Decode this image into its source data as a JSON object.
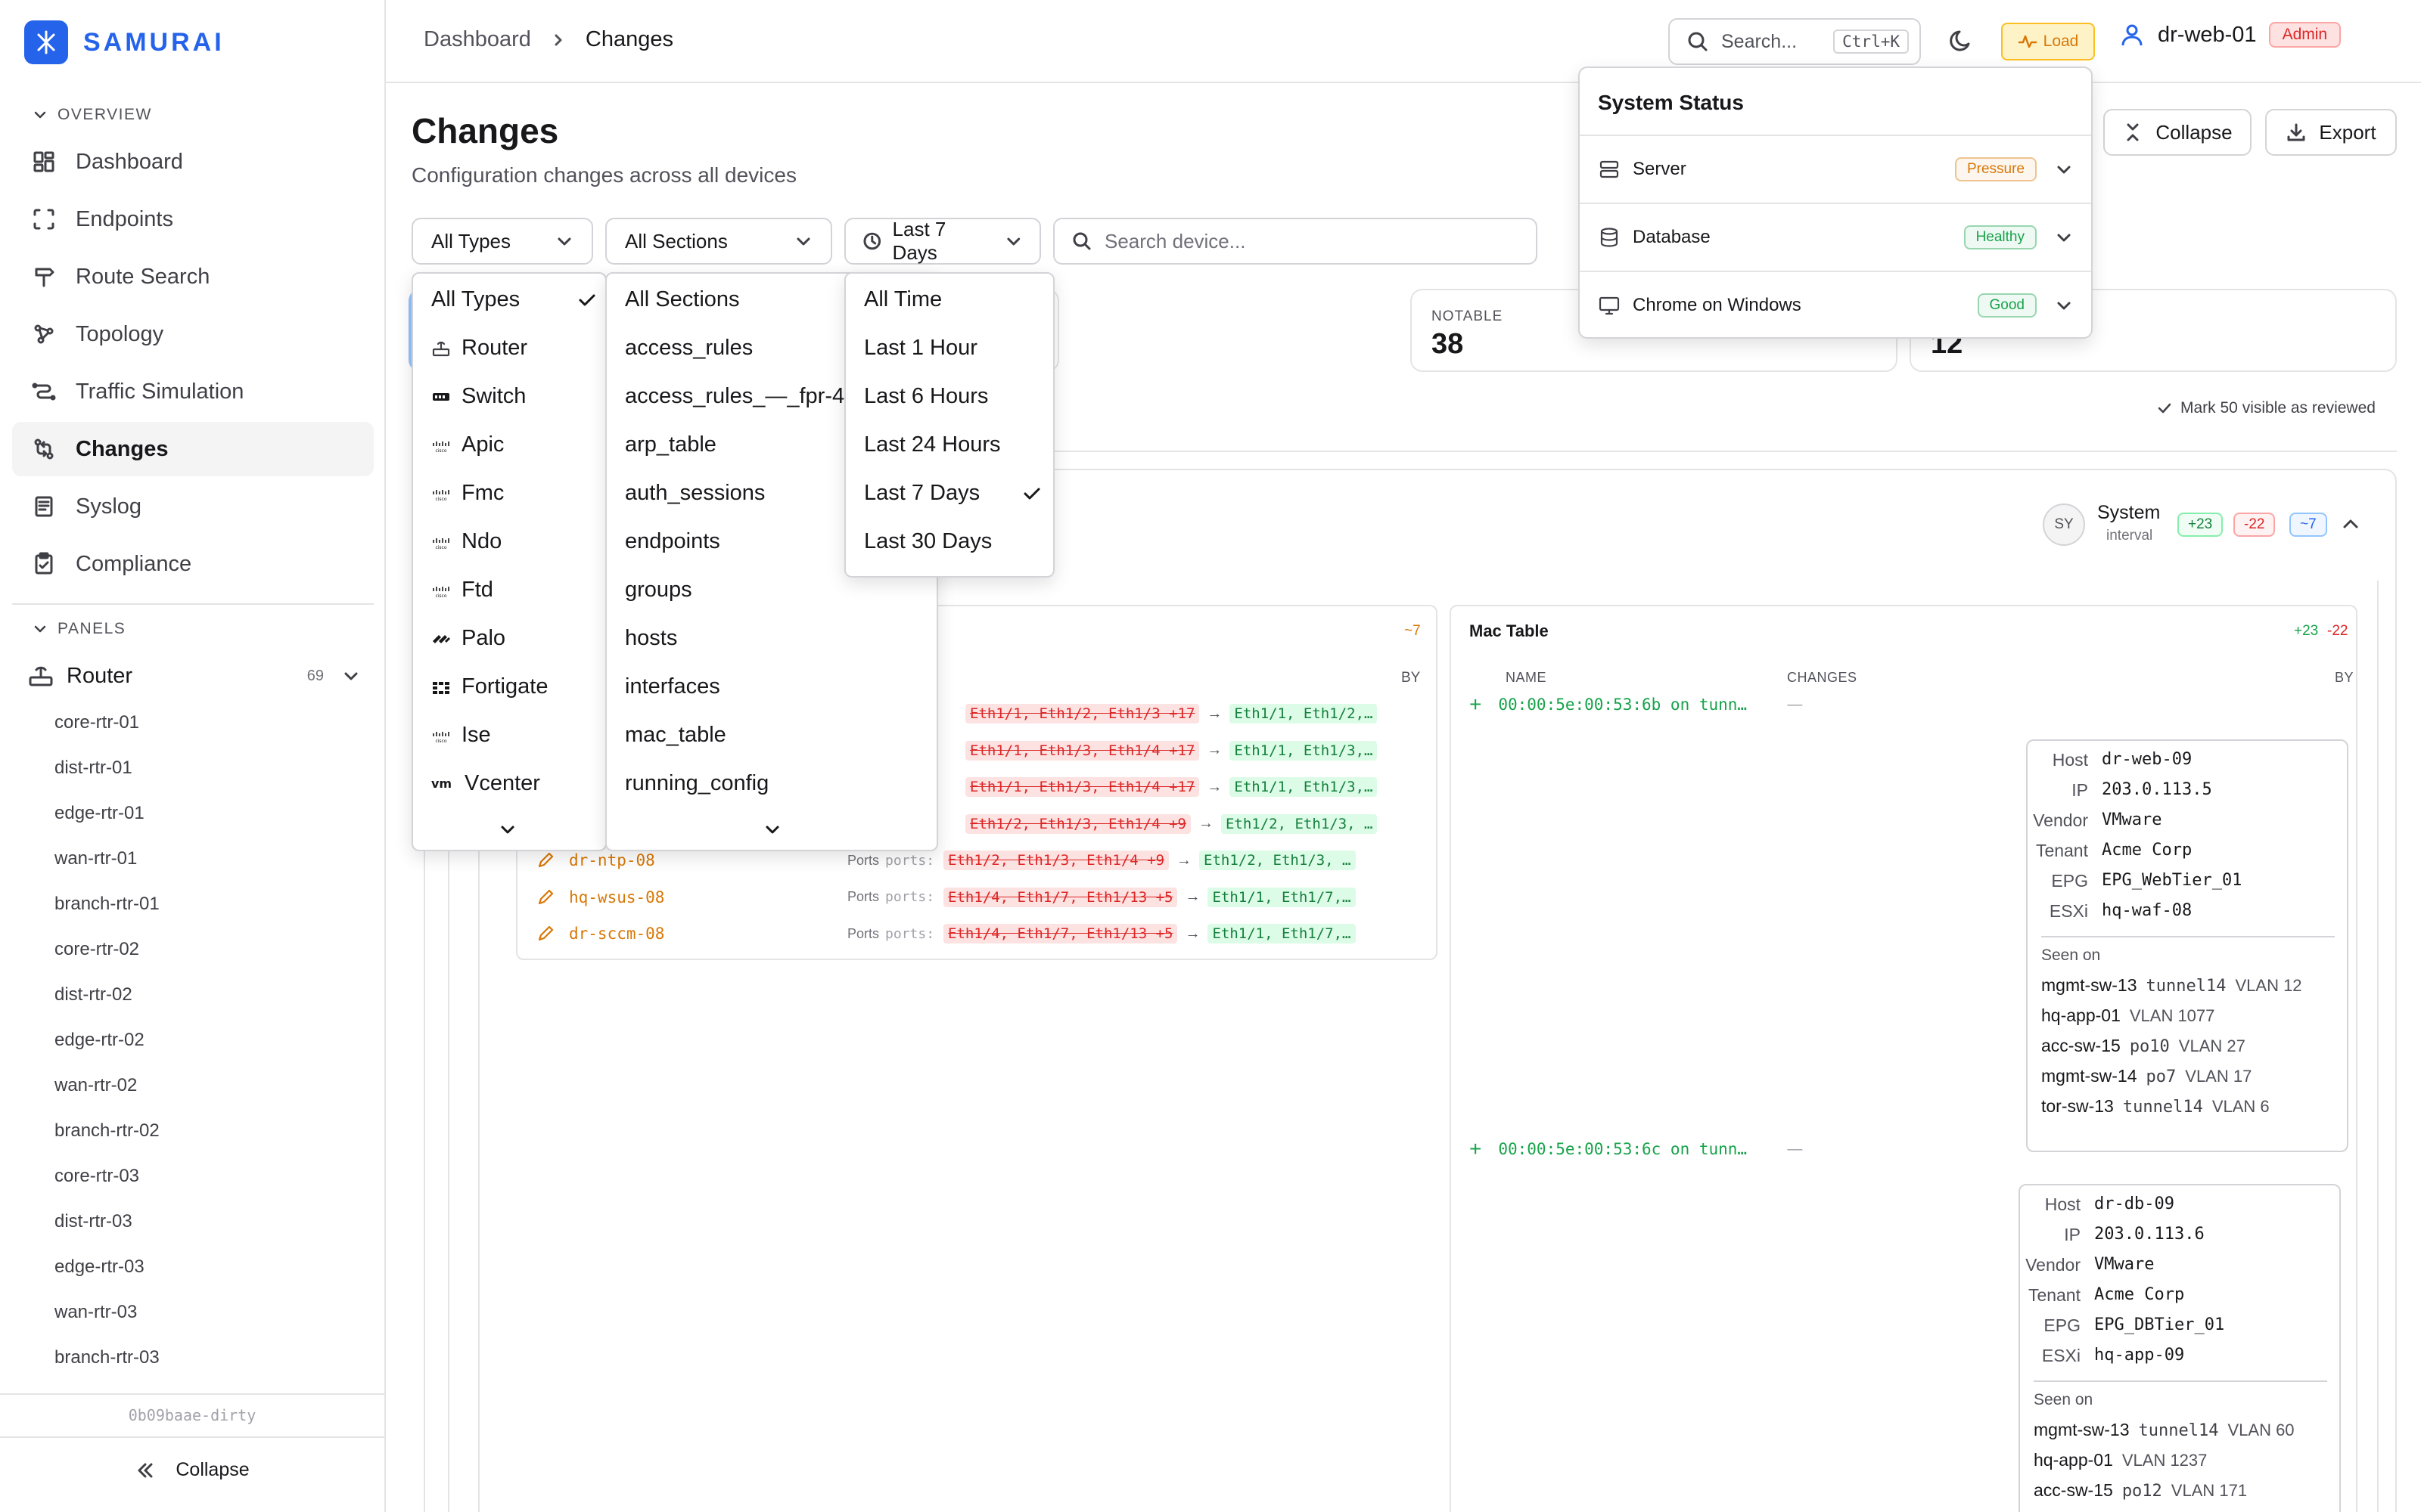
{
  "app": {
    "name": "SAMURAI",
    "version": "0b09baae-dirty"
  },
  "sidebar": {
    "overview_label": "OVERVIEW",
    "nav": [
      {
        "label": "Dashboard",
        "icon": "dashboard-icon"
      },
      {
        "label": "Endpoints",
        "icon": "endpoints-icon"
      },
      {
        "label": "Route Search",
        "icon": "route-search-icon"
      },
      {
        "label": "Topology",
        "icon": "topology-icon"
      },
      {
        "label": "Traffic Simulation",
        "icon": "traffic-icon"
      },
      {
        "label": "Changes",
        "icon": "changes-icon",
        "active": true
      },
      {
        "label": "Syslog",
        "icon": "syslog-icon"
      },
      {
        "label": "Compliance",
        "icon": "compliance-icon"
      }
    ],
    "panels_label": "PANELS",
    "router_group": {
      "label": "Router",
      "count": "69"
    },
    "routers": [
      "core-rtr-01",
      "dist-rtr-01",
      "edge-rtr-01",
      "wan-rtr-01",
      "branch-rtr-01",
      "core-rtr-02",
      "dist-rtr-02",
      "edge-rtr-02",
      "wan-rtr-02",
      "branch-rtr-02",
      "core-rtr-03",
      "dist-rtr-03",
      "edge-rtr-03",
      "wan-rtr-03",
      "branch-rtr-03"
    ],
    "collapse_label": "Collapse"
  },
  "header": {
    "breadcrumb": [
      "Dashboard",
      "Changes"
    ],
    "search_placeholder": "Search...",
    "search_shortcut": "Ctrl+K",
    "load_label": "Load",
    "user": "dr-web-01",
    "role": "Admin"
  },
  "page": {
    "title": "Changes",
    "subtitle": "Configuration changes across all devices",
    "collapse_label": "Collapse",
    "export_label": "Export",
    "filters": {
      "types": "All Types",
      "sections": "All Sections",
      "time": "Last 7 Days",
      "search_placeholder": "Search device..."
    },
    "stats": [
      {
        "label": "NOTABLE",
        "value": "38"
      },
      {
        "label": "",
        "value": "12"
      }
    ],
    "mark_reviewed": "Mark 50 visible as reviewed"
  },
  "types_menu": {
    "items": [
      {
        "label": "All Types",
        "checked": true
      },
      {
        "label": "Router"
      },
      {
        "label": "Switch"
      },
      {
        "label": "Apic"
      },
      {
        "label": "Fmc"
      },
      {
        "label": "Ndo"
      },
      {
        "label": "Ftd"
      },
      {
        "label": "Palo"
      },
      {
        "label": "Fortigate"
      },
      {
        "label": "Ise"
      },
      {
        "label": "Vcenter"
      }
    ]
  },
  "sections_menu": {
    "items": [
      "All Sections",
      "access_rules",
      "access_rules_—_fpr-4",
      "arp_table",
      "auth_sessions",
      "endpoints",
      "groups",
      "hosts",
      "interfaces",
      "mac_table",
      "running_config"
    ]
  },
  "time_menu": {
    "items": [
      {
        "label": "All Time"
      },
      {
        "label": "Last 1 Hour"
      },
      {
        "label": "Last 6 Hours"
      },
      {
        "label": "Last 24 Hours"
      },
      {
        "label": "Last 7 Days",
        "checked": true
      },
      {
        "label": "Last 30 Days"
      }
    ]
  },
  "status_popup": {
    "title": "System Status",
    "rows": [
      {
        "label": "Server",
        "status": "Pressure",
        "color": "#d97706"
      },
      {
        "label": "Database",
        "status": "Healthy",
        "color": "#16a34a"
      },
      {
        "label": "Chrome on Windows",
        "status": "Good",
        "color": "#16a34a"
      }
    ]
  },
  "group": {
    "avatar": "SY",
    "name": "System",
    "sub": "interval",
    "plus": "+23",
    "minus": "-22",
    "mod": "~7"
  },
  "interfaces_panel": {
    "mod": "~7",
    "by_label": "BY",
    "rows": [
      {
        "device": "",
        "old": "Eth1/1, Eth1/2, Eth1/3 +17",
        "new": "Eth1/1, Eth1/2,…"
      },
      {
        "device": "",
        "old": "Eth1/1, Eth1/3, Eth1/4 +17",
        "new": "Eth1/1, Eth1/3,…"
      },
      {
        "device": "",
        "old": "Eth1/1, Eth1/3, Eth1/4 +17",
        "new": "Eth1/1, Eth1/3,…"
      },
      {
        "device": "",
        "old": "Eth1/2, Eth1/3, Eth1/4 +9",
        "new": "Eth1/2, Eth1/3, …"
      },
      {
        "device": "dr-ntp-08",
        "old": "Eth1/2, Eth1/3, Eth1/4 +9",
        "new": "Eth1/2, Eth1/3, …"
      },
      {
        "device": "hq-wsus-08",
        "old": "Eth1/4, Eth1/7, Eth1/13 +5",
        "new": "Eth1/1, Eth1/7,…"
      },
      {
        "device": "dr-sccm-08",
        "old": "Eth1/4, Eth1/7, Eth1/13 +5",
        "new": "Eth1/1, Eth1/7,…"
      }
    ],
    "ports_label": "Ports",
    "ports_key": "ports:"
  },
  "mac_panel": {
    "title": "Mac Table",
    "plus": "+23",
    "minus": "-22",
    "col_name": "NAME",
    "col_changes": "CHANGES",
    "col_by": "BY",
    "entries": [
      {
        "name": "00:00:5e:00:53:6b on tunn…",
        "dash": "—",
        "host": "dr-web-09",
        "ip": "203.0.113.5",
        "vendor": "VMware",
        "tenant": "Acme Corp",
        "epg": "EPG_WebTier_01",
        "esxi": "hq-waf-08",
        "seen": [
          {
            "dev": "mgmt-sw-13",
            "port": "tunnel14",
            "vlan": "VLAN 12"
          },
          {
            "dev": "hq-app-01",
            "port": "",
            "vlan": "VLAN 1077"
          },
          {
            "dev": "acc-sw-15",
            "port": "po10",
            "vlan": "VLAN 27"
          },
          {
            "dev": "mgmt-sw-14",
            "port": "po7",
            "vlan": "VLAN 17"
          },
          {
            "dev": "tor-sw-13",
            "port": "tunnel14",
            "vlan": "VLAN 6"
          }
        ]
      },
      {
        "name": "00:00:5e:00:53:6c on tunn…",
        "dash": "—",
        "host": "dr-db-09",
        "ip": "203.0.113.6",
        "vendor": "VMware",
        "tenant": "Acme Corp",
        "epg": "EPG_DBTier_01",
        "esxi": "hq-app-09",
        "seen": [
          {
            "dev": "mgmt-sw-13",
            "port": "tunnel14",
            "vlan": "VLAN 60"
          },
          {
            "dev": "hq-app-01",
            "port": "",
            "vlan": "VLAN 1237"
          },
          {
            "dev": "acc-sw-15",
            "port": "po12",
            "vlan": "VLAN 171"
          }
        ]
      }
    ],
    "labels": {
      "host": "Host",
      "ip": "IP",
      "vendor": "Vendor",
      "tenant": "Tenant",
      "epg": "EPG",
      "esxi": "ESXi",
      "seen_on": "Seen on"
    }
  }
}
